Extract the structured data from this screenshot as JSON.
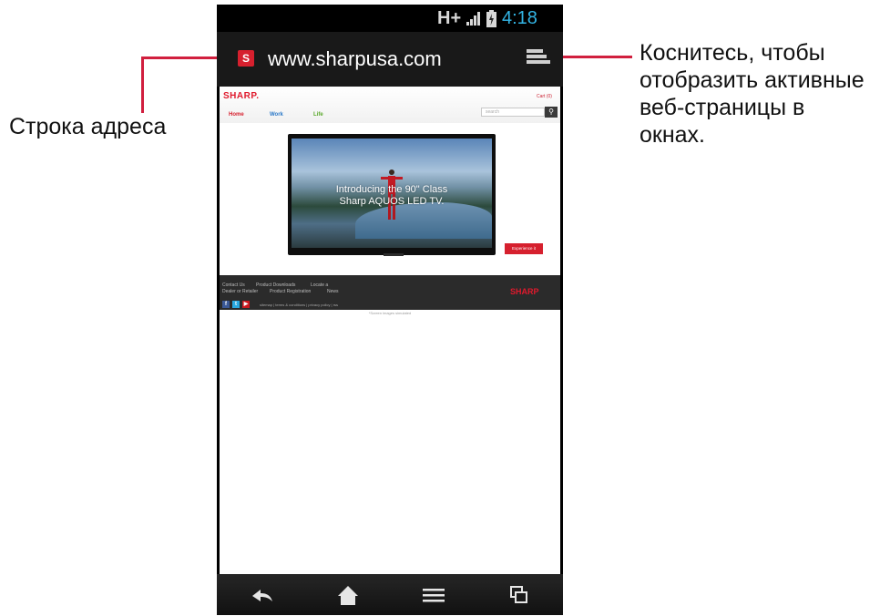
{
  "status_bar": {
    "network": "H+",
    "time": "4:18"
  },
  "url_bar": {
    "favicon_letter": "S",
    "url": "www.sharpusa.com"
  },
  "webpage": {
    "logo": "SHARP.",
    "cart": "Cart (0)",
    "nav": [
      "Home",
      "Work",
      "Life"
    ],
    "search_placeholder": "search",
    "hero_line1": "Introducing the 90\" Class",
    "hero_line2": "Sharp AQUOS LED TV.",
    "cta": "Experience it",
    "footer_links": [
      "Contact Us",
      "Product Downloads",
      "Locate a",
      "Dealer or Retailer",
      "Product Registration",
      "News"
    ],
    "footer_logo": "SHARP",
    "footer_legal": "sitemap | terms & conditions | privacy policy | rss",
    "footnote": "*Screen images simulated"
  },
  "annotations": {
    "address_bar_label": "Строка адреса",
    "windows_label_line1": "Коснитесь, чтобы",
    "windows_label_line2": "отобразить активные",
    "windows_label_line3": "веб-страницы в",
    "windows_label_line4": "окнах."
  },
  "colors": {
    "callout": "#d11f3e",
    "status_time": "#33b5e5",
    "brand_red": "#e0192c",
    "nav_home": "#d6202e",
    "nav_work": "#2a78c8",
    "nav_life": "#59a82a"
  },
  "icons": {
    "nav_bar": [
      "back-icon",
      "home-icon",
      "menu-icon",
      "windows-icon"
    ],
    "status": [
      "signal-icon",
      "battery-icon"
    ]
  }
}
